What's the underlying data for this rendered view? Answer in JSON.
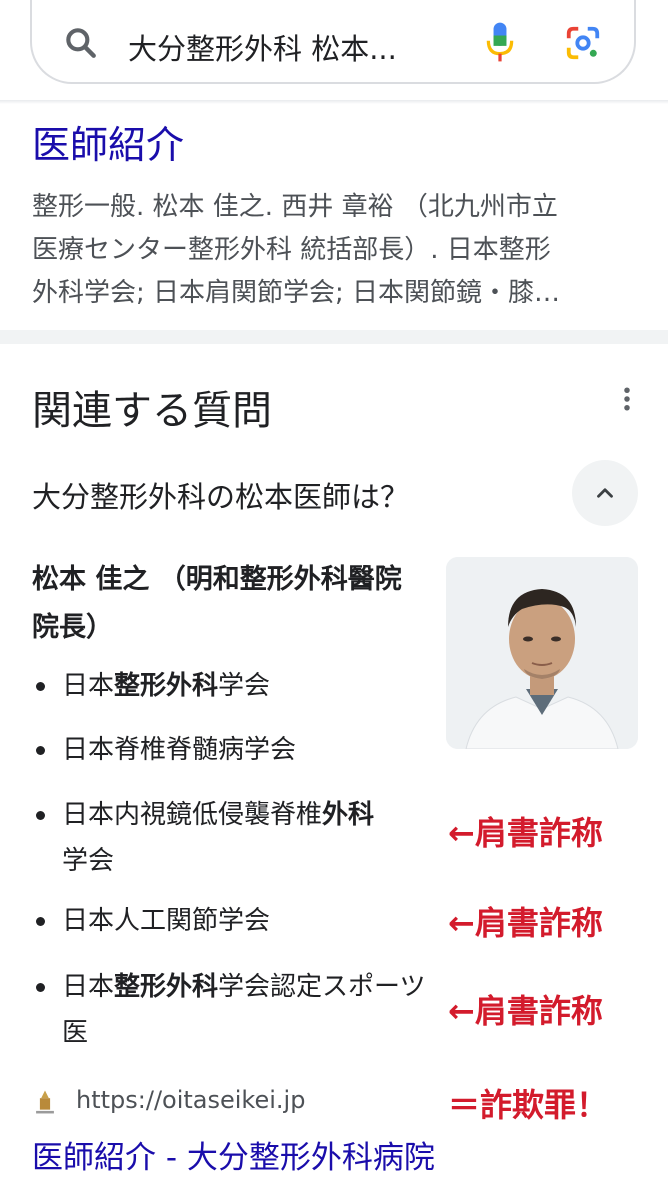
{
  "search": {
    "query": "大分整形外科 松本..."
  },
  "result": {
    "title": "医師紹介",
    "snippet_lines": [
      "整形一般. 松本 佳之. 西井 章裕 （北九州市立",
      "医療センター整形外科 統括部長）. 日本整形",
      "外科学会; 日本肩関節学会; 日本関節鏡・膝…"
    ]
  },
  "paa": {
    "heading": "関連する質問",
    "question": "大分整形外科の松本医師は？",
    "answer_title": "松本 佳之 （明和整形外科醫院 院長）",
    "items": [
      {
        "pre": "日本",
        "bold": "整形外科",
        "post": "学会"
      },
      {
        "pre": "日本脊椎脊髄病学会",
        "bold": "",
        "post": ""
      },
      {
        "pre": "日本内視鏡低侵襲脊椎",
        "bold": "外科",
        "post": "学会"
      },
      {
        "pre": "日本人工関節学会",
        "bold": "",
        "post": ""
      },
      {
        "pre": "日本",
        "bold": "整形外科",
        "post": "学会認定スポーツ医"
      }
    ],
    "source_url": "https://oitaseikei.jp",
    "link_title": "医師紹介 - 大分整形外科病院"
  },
  "annotations": [
    "←肩書詐称",
    "←肩書詐称",
    "←肩書詐称",
    "＝詐欺罪！"
  ],
  "colors": {
    "link": "#1a0dab",
    "annotation": "#d31b2c",
    "text": "#202124",
    "muted": "#4d5156"
  }
}
